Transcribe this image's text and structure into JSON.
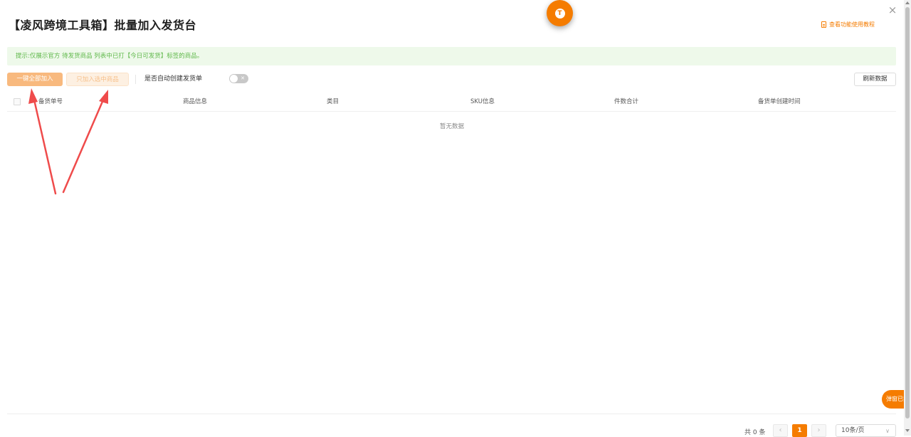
{
  "dialog": {
    "title": "【凌风跨境工具箱】批量加入发货台",
    "close_icon": "×",
    "fab_letter": "T",
    "tutorial_link": "查看功能使用教程"
  },
  "notice": {
    "text": "提示:仅展示官方 待发货商品 列表中已打【今日可发货】标签的商品。"
  },
  "toolbar": {
    "add_all_label": "一键全部加入",
    "add_selected_label": "只加入选中商品",
    "auto_create_label": "是否自动创建发货单",
    "auto_create_enabled": false,
    "refresh_label": "刷新数据"
  },
  "table": {
    "columns": [
      "备货单号",
      "商品信息",
      "类目",
      "SKU信息",
      "件数合计",
      "备货单创建时间"
    ],
    "rows": [],
    "empty_text": "暂无数据"
  },
  "pagination": {
    "total_text": "共 0 条",
    "prev_icon": "‹",
    "current_page": "1",
    "next_icon": "›",
    "page_size": "10条/页"
  },
  "side_badge": {
    "text": "弹窗已禁用"
  },
  "colors": {
    "accent": "#f57c00",
    "notice_bg": "#eef9ea",
    "notice_text": "#5fb84a",
    "annotation_arrow": "#ef4b4b"
  }
}
